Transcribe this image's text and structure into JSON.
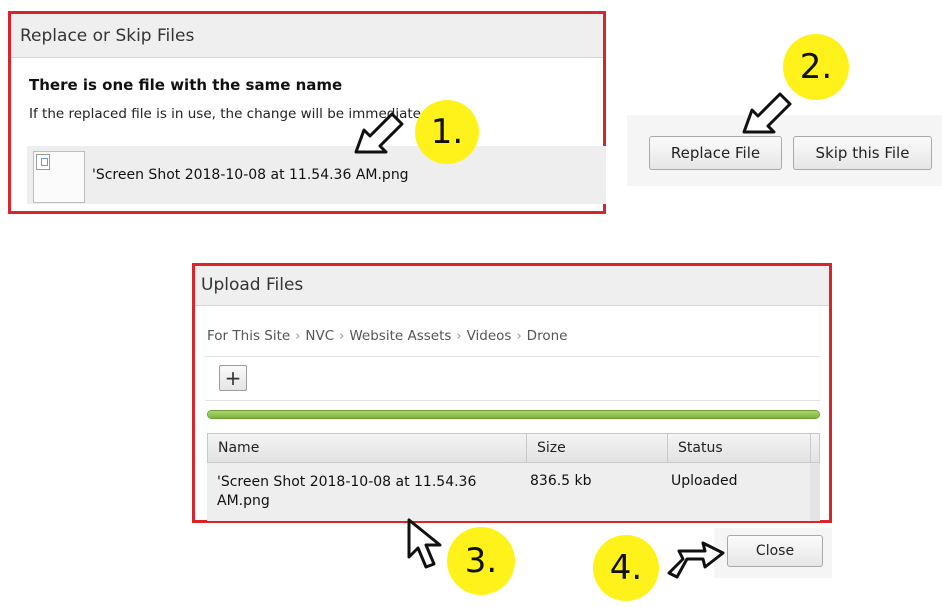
{
  "replace_dialog": {
    "title": "Replace or Skip Files",
    "heading": "There is one file with the same name",
    "description": "If the replaced file is in use, the change will be immediate.",
    "file_name": "'Screen Shot 2018-10-08 at 11.54.36 AM.png"
  },
  "replace_buttons": {
    "replace_label": "Replace File",
    "skip_label": "Skip this File"
  },
  "upload_dialog": {
    "title": "Upload Files",
    "breadcrumb": [
      "For This Site",
      "NVC",
      "Website Assets",
      "Videos",
      "Drone"
    ],
    "add_symbol": "+",
    "progress_fraction": 1.0,
    "table": {
      "columns": [
        "Name",
        "Size",
        "Status"
      ],
      "rows": [
        {
          "name": "'Screen Shot 2018-10-08 at 11.54.36 AM.png",
          "size": "836.5 kb",
          "status": "Uploaded"
        }
      ]
    },
    "close_label": "Close"
  },
  "annotations": {
    "step1": "1.",
    "step2": "2.",
    "step3": "3.",
    "step4": "4."
  },
  "colors": {
    "highlight_border": "#d9242b",
    "badge": "#fff21a",
    "progress": "#8bc34a"
  },
  "icons": [
    "broken-image-icon",
    "chevron-right-icon",
    "plus-icon",
    "pointer-arrow-icon",
    "hand-cursor-icon"
  ]
}
